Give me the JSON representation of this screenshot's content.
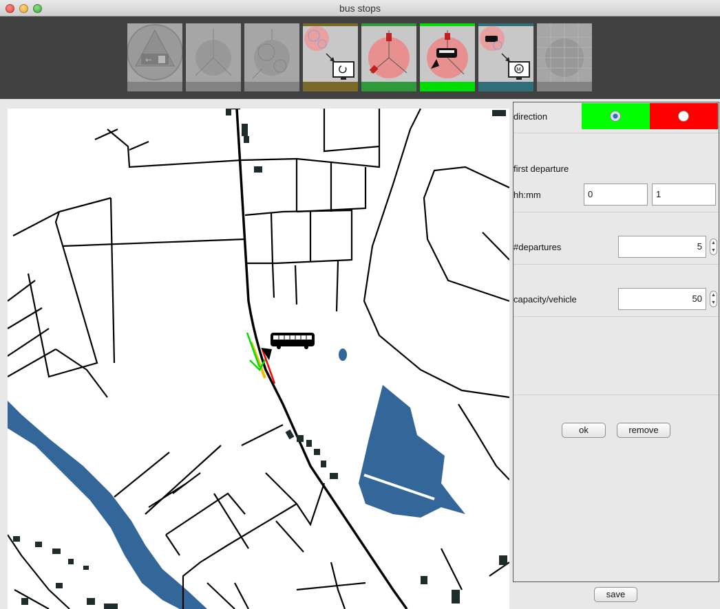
{
  "window": {
    "title": "bus stops"
  },
  "toolbar": {
    "tools": [
      {
        "name": "exit-stop-tool",
        "state": "disabled",
        "strip_color": "#9a9a9a"
      },
      {
        "name": "split-tool",
        "state": "disabled",
        "strip_color": "#9a9a9a"
      },
      {
        "name": "circles-tool",
        "state": "disabled",
        "strip_color": "#9a9a9a"
      },
      {
        "name": "export-monitor-tool",
        "state": "enabled",
        "strip_color": "#7a6a2a"
      },
      {
        "name": "place-stops-tool",
        "state": "enabled",
        "strip_color": "#2e9a3a"
      },
      {
        "name": "bus-schedule-tool",
        "state": "active",
        "strip_color": "#00dd00"
      },
      {
        "name": "bus-monitor-tool",
        "state": "enabled",
        "strip_color": "#2f6f7a"
      },
      {
        "name": "grid-tool",
        "state": "disabled",
        "strip_color": "#9a9a9a"
      }
    ]
  },
  "map": {
    "water_color": "#336699",
    "building_color": "#1e2b2b",
    "direction_forward_color": "#00dd00",
    "direction_backward_color": "#ff0000",
    "stop_marker_color": "#e8c000"
  },
  "panel": {
    "direction": {
      "label": "direction",
      "forward_color": "#00ff00",
      "backward_color": "#ff0000",
      "selected": "forward"
    },
    "first_departure": {
      "label": "first departure",
      "time_label": "hh:mm",
      "hours": "0",
      "minutes": "1"
    },
    "departures": {
      "label": "#departures",
      "value": "5"
    },
    "capacity": {
      "label": "capacity/vehicle",
      "value": "50"
    },
    "ok_label": "ok",
    "remove_label": "remove"
  },
  "save_label": "save"
}
